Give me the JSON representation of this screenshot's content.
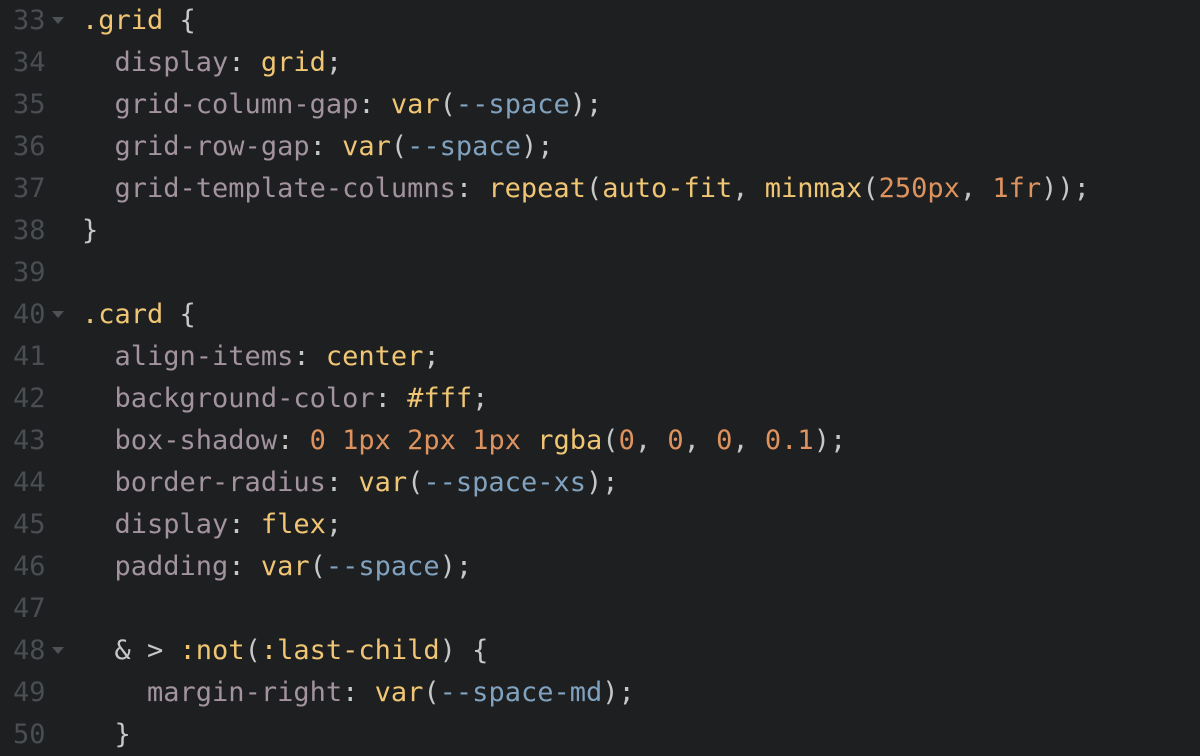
{
  "colors": {
    "background": "#1d1f21",
    "line_number": "#4a4d51",
    "fold_arrow": "#4f5256",
    "default": "#c5c8c6",
    "selector": "#f0c674",
    "property": "#a3939f",
    "value": "#f0c674",
    "variable": "#81a2be",
    "number": "#de935f",
    "punct": "#c5c8c6"
  },
  "lines": [
    {
      "num": "33",
      "fold": true,
      "tokens": [
        {
          "t": ".grid",
          "c": "selector"
        },
        {
          "t": " {",
          "c": "punct"
        }
      ]
    },
    {
      "num": "34",
      "fold": false,
      "tokens": [
        {
          "t": "  ",
          "c": "punct"
        },
        {
          "t": "display",
          "c": "property"
        },
        {
          "t": ": ",
          "c": "punct"
        },
        {
          "t": "grid",
          "c": "value"
        },
        {
          "t": ";",
          "c": "punct"
        }
      ]
    },
    {
      "num": "35",
      "fold": false,
      "tokens": [
        {
          "t": "  ",
          "c": "punct"
        },
        {
          "t": "grid-column-gap",
          "c": "property"
        },
        {
          "t": ": ",
          "c": "punct"
        },
        {
          "t": "var",
          "c": "value"
        },
        {
          "t": "(",
          "c": "punct"
        },
        {
          "t": "--space",
          "c": "variable"
        },
        {
          "t": ");",
          "c": "punct"
        }
      ]
    },
    {
      "num": "36",
      "fold": false,
      "tokens": [
        {
          "t": "  ",
          "c": "punct"
        },
        {
          "t": "grid-row-gap",
          "c": "property"
        },
        {
          "t": ": ",
          "c": "punct"
        },
        {
          "t": "var",
          "c": "value"
        },
        {
          "t": "(",
          "c": "punct"
        },
        {
          "t": "--space",
          "c": "variable"
        },
        {
          "t": ");",
          "c": "punct"
        }
      ]
    },
    {
      "num": "37",
      "fold": false,
      "tokens": [
        {
          "t": "  ",
          "c": "punct"
        },
        {
          "t": "grid-template-columns",
          "c": "property"
        },
        {
          "t": ": ",
          "c": "punct"
        },
        {
          "t": "repeat",
          "c": "value"
        },
        {
          "t": "(",
          "c": "punct"
        },
        {
          "t": "auto-fit",
          "c": "value"
        },
        {
          "t": ", ",
          "c": "punct"
        },
        {
          "t": "minmax",
          "c": "value"
        },
        {
          "t": "(",
          "c": "punct"
        },
        {
          "t": "250px",
          "c": "number"
        },
        {
          "t": ", ",
          "c": "punct"
        },
        {
          "t": "1fr",
          "c": "number"
        },
        {
          "t": "));",
          "c": "punct"
        }
      ]
    },
    {
      "num": "38",
      "fold": false,
      "tokens": [
        {
          "t": "}",
          "c": "punct"
        }
      ]
    },
    {
      "num": "39",
      "fold": false,
      "tokens": []
    },
    {
      "num": "40",
      "fold": true,
      "tokens": [
        {
          "t": ".card",
          "c": "selector"
        },
        {
          "t": " {",
          "c": "punct"
        }
      ]
    },
    {
      "num": "41",
      "fold": false,
      "tokens": [
        {
          "t": "  ",
          "c": "punct"
        },
        {
          "t": "align-items",
          "c": "property"
        },
        {
          "t": ": ",
          "c": "punct"
        },
        {
          "t": "center",
          "c": "value"
        },
        {
          "t": ";",
          "c": "punct"
        }
      ]
    },
    {
      "num": "42",
      "fold": false,
      "tokens": [
        {
          "t": "  ",
          "c": "punct"
        },
        {
          "t": "background-color",
          "c": "property"
        },
        {
          "t": ": ",
          "c": "punct"
        },
        {
          "t": "#fff",
          "c": "value"
        },
        {
          "t": ";",
          "c": "punct"
        }
      ]
    },
    {
      "num": "43",
      "fold": false,
      "tokens": [
        {
          "t": "  ",
          "c": "punct"
        },
        {
          "t": "box-shadow",
          "c": "property"
        },
        {
          "t": ": ",
          "c": "punct"
        },
        {
          "t": "0",
          "c": "number"
        },
        {
          "t": " ",
          "c": "punct"
        },
        {
          "t": "1px",
          "c": "number"
        },
        {
          "t": " ",
          "c": "punct"
        },
        {
          "t": "2px",
          "c": "number"
        },
        {
          "t": " ",
          "c": "punct"
        },
        {
          "t": "1px",
          "c": "number"
        },
        {
          "t": " ",
          "c": "punct"
        },
        {
          "t": "rgba",
          "c": "value"
        },
        {
          "t": "(",
          "c": "punct"
        },
        {
          "t": "0",
          "c": "number"
        },
        {
          "t": ", ",
          "c": "punct"
        },
        {
          "t": "0",
          "c": "number"
        },
        {
          "t": ", ",
          "c": "punct"
        },
        {
          "t": "0",
          "c": "number"
        },
        {
          "t": ", ",
          "c": "punct"
        },
        {
          "t": "0.1",
          "c": "number"
        },
        {
          "t": ");",
          "c": "punct"
        }
      ]
    },
    {
      "num": "44",
      "fold": false,
      "tokens": [
        {
          "t": "  ",
          "c": "punct"
        },
        {
          "t": "border-radius",
          "c": "property"
        },
        {
          "t": ": ",
          "c": "punct"
        },
        {
          "t": "var",
          "c": "value"
        },
        {
          "t": "(",
          "c": "punct"
        },
        {
          "t": "--space-xs",
          "c": "variable"
        },
        {
          "t": ");",
          "c": "punct"
        }
      ]
    },
    {
      "num": "45",
      "fold": false,
      "tokens": [
        {
          "t": "  ",
          "c": "punct"
        },
        {
          "t": "display",
          "c": "property"
        },
        {
          "t": ": ",
          "c": "punct"
        },
        {
          "t": "flex",
          "c": "value"
        },
        {
          "t": ";",
          "c": "punct"
        }
      ]
    },
    {
      "num": "46",
      "fold": false,
      "tokens": [
        {
          "t": "  ",
          "c": "punct"
        },
        {
          "t": "padding",
          "c": "property"
        },
        {
          "t": ": ",
          "c": "punct"
        },
        {
          "t": "var",
          "c": "value"
        },
        {
          "t": "(",
          "c": "punct"
        },
        {
          "t": "--space",
          "c": "variable"
        },
        {
          "t": ");",
          "c": "punct"
        }
      ]
    },
    {
      "num": "47",
      "fold": false,
      "tokens": []
    },
    {
      "num": "48",
      "fold": true,
      "tokens": [
        {
          "t": "  ",
          "c": "punct"
        },
        {
          "t": "& > ",
          "c": "punct"
        },
        {
          "t": ":not",
          "c": "value"
        },
        {
          "t": "(",
          "c": "punct"
        },
        {
          "t": ":last-child",
          "c": "value"
        },
        {
          "t": ") {",
          "c": "punct"
        }
      ]
    },
    {
      "num": "49",
      "fold": false,
      "tokens": [
        {
          "t": "    ",
          "c": "punct"
        },
        {
          "t": "margin-right",
          "c": "property"
        },
        {
          "t": ": ",
          "c": "punct"
        },
        {
          "t": "var",
          "c": "value"
        },
        {
          "t": "(",
          "c": "punct"
        },
        {
          "t": "--space-md",
          "c": "variable"
        },
        {
          "t": ");",
          "c": "punct"
        }
      ]
    },
    {
      "num": "50",
      "fold": false,
      "tokens": [
        {
          "t": "  ",
          "c": "punct"
        },
        {
          "t": "}",
          "c": "punct"
        }
      ]
    }
  ]
}
